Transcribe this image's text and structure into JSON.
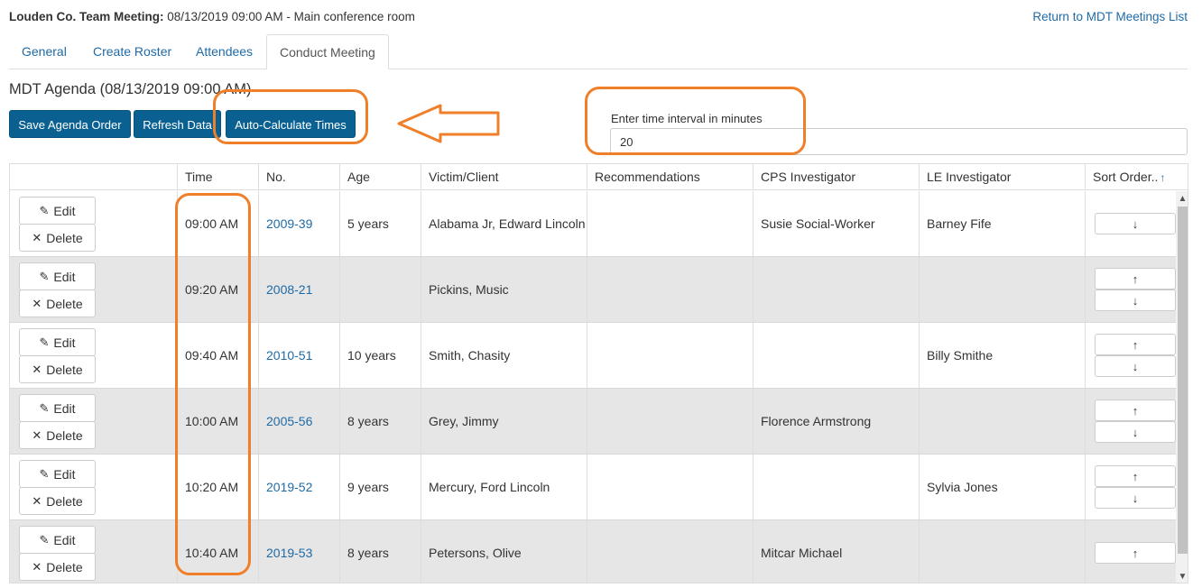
{
  "header": {
    "title": "Louden Co. Team Meeting:",
    "subtitle": "08/13/2019 09:00 AM - Main conference room",
    "return_link": "Return to MDT Meetings List"
  },
  "tabs": [
    {
      "label": "General"
    },
    {
      "label": "Create Roster"
    },
    {
      "label": "Attendees"
    },
    {
      "label": "Conduct Meeting"
    }
  ],
  "agenda": {
    "title": "MDT Agenda (08/13/2019 09:00 AM)",
    "buttons": {
      "save": "Save Agenda Order",
      "refresh": "Refresh Data",
      "auto": "Auto-Calculate Times"
    },
    "interval_label": "Enter time interval in minutes",
    "interval_value": "20"
  },
  "table": {
    "columns": [
      "",
      "Time",
      "No.",
      "Age",
      "Victim/Client",
      "Recommendations",
      "CPS Investigator",
      "LE Investigator",
      "Sort Order.."
    ],
    "sort_arrow": "↑",
    "edit_label": "Edit",
    "delete_label": "Delete",
    "edit_icon": "✎",
    "delete_icon": "✕",
    "up_arrow": "↑",
    "down_arrow": "↓",
    "rows": [
      {
        "time": "09:00 AM",
        "no": "2009-39",
        "age": "5 years",
        "client": "Alabama Jr, Edward Lincoln",
        "recommendations": "",
        "cps": "Susie Social-Worker",
        "le": "Barney Fife"
      },
      {
        "time": "09:20 AM",
        "no": "2008-21",
        "age": "",
        "client": "Pickins, Music",
        "recommendations": "",
        "cps": "",
        "le": ""
      },
      {
        "time": "09:40 AM",
        "no": "2010-51",
        "age": "10 years",
        "client": "Smith, Chasity",
        "recommendations": "",
        "cps": "",
        "le": "Billy Smithe"
      },
      {
        "time": "10:00 AM",
        "no": "2005-56",
        "age": "8 years",
        "client": "Grey, Jimmy",
        "recommendations": "",
        "cps": "Florence Armstrong",
        "le": ""
      },
      {
        "time": "10:20 AM",
        "no": "2019-52",
        "age": "9 years",
        "client": "Mercury, Ford Lincoln",
        "recommendations": "",
        "cps": "",
        "le": "Sylvia Jones"
      },
      {
        "time": "10:40 AM",
        "no": "2019-53",
        "age": "8 years",
        "client": "Petersons, Olive",
        "recommendations": "",
        "cps": "Mitcar Michael",
        "le": ""
      }
    ]
  },
  "scrollbar": {
    "up": "▲",
    "down": "▼"
  },
  "colors": {
    "accent": "#0a6191",
    "link": "#1f6aa5",
    "annotation": "#f07f2a",
    "row_alt": "#e6e6e6"
  }
}
